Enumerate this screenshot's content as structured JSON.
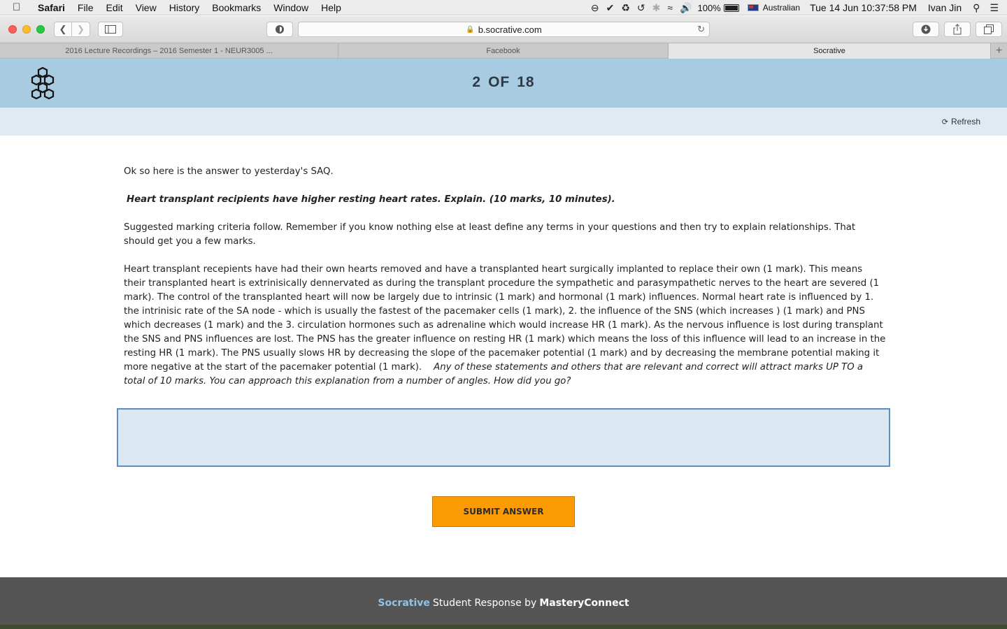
{
  "menubar": {
    "app": "Safari",
    "items": [
      "File",
      "Edit",
      "View",
      "History",
      "Bookmarks",
      "Window",
      "Help"
    ],
    "battery": "100%",
    "input_source": "Australian",
    "clock": "Tue 14 Jun  10:37:58 PM",
    "user": "Ivan Jin"
  },
  "browser": {
    "url": "b.socrative.com",
    "tabs": [
      {
        "label": "2016 Lecture Recordings – 2016 Semester 1 - NEUR3005 ...",
        "active": false
      },
      {
        "label": "Facebook",
        "active": false
      },
      {
        "label": "Socrative",
        "active": true
      }
    ]
  },
  "header": {
    "current": "2",
    "of": "OF",
    "total": "18"
  },
  "subbar": {
    "refresh_label": "Refresh"
  },
  "content": {
    "intro": "Ok so here is the answer to yesterday's SAQ.",
    "question": "Heart transplant recipients have higher resting heart rates. Explain. (10 marks, 10 minutes).",
    "criteria": "Suggested marking criteria follow. Remember if you know nothing else at least define any terms in your questions and then try to explain relationships.  That should get you a few marks.",
    "answer": "Heart transplant recepients have had their own hearts removed and have a transplanted heart surgically implanted to replace their own (1 mark).  This means their transplanted heart is extrinisically dennervated as during the transplant procedure the sympathetic and parasympathetic nerves to the heart are severed (1 mark).  The control of the transplanted heart will now be largely due to intrinsic (1 mark) and hormonal (1 mark) influences.  Normal heart rate is influenced by 1. the intrinisic rate of the SA node  - which is usually the fastest of the pacemaker cells (1 mark), 2. the influence of the SNS (which increases ) (1 mark) and PNS which decreases  (1 mark) and the 3. circulation hormones such as adrenaline which would increase HR (1 mark).  As the nervous influence is lost during transplant the SNS and PNS influences are lost.  The PNS has the greater influence on resting HR (1 mark) which means the loss of this influence will lead to an increase in the resting HR (1 mark).  The PNS usually slows HR by decreasing the slope of the pacemaker potential (1 mark) and by decreasing the membrane potential making it more negative at the start of the pacemaker potential (1 mark).",
    "closing": "Any of these statements and others that are relevant and correct will attract marks UP TO a total of 10 marks.  You can approach this explanation from a number of angles.  How did you go?"
  },
  "answer_input": {
    "value": "",
    "placeholder": ""
  },
  "submit_label": "SUBMIT ANSWER",
  "footer": {
    "brand": "Socrative",
    "middle": "Student Response by",
    "company": "MasteryConnect"
  },
  "colors": {
    "header_bg": "#a9cbe2",
    "subbar_bg": "#dfeaf3",
    "submit_bg": "#fb9c05",
    "footer_bg": "#555555",
    "brand_accent": "#8fc3ea"
  }
}
